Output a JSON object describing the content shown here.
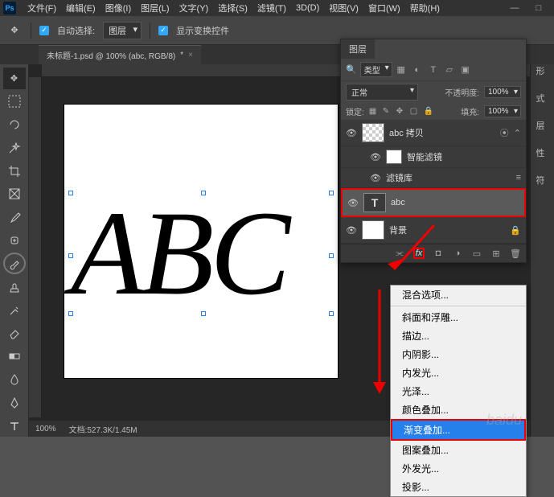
{
  "menu": [
    "文件(F)",
    "编辑(E)",
    "图像(I)",
    "图层(L)",
    "文字(Y)",
    "选择(S)",
    "滤镜(T)",
    "3D(D)",
    "视图(V)",
    "窗口(W)",
    "帮助(H)"
  ],
  "optbar": {
    "auto_select": "自动选择:",
    "layer": "图层",
    "show_transform": "显示变换控件"
  },
  "doctab": {
    "title": "未标题-1.psd @ 100% (abc, RGB/8)",
    "marker": "*"
  },
  "canvas": {
    "text": "ABC"
  },
  "status": {
    "zoom": "100%",
    "doc": "文档:527.3K/1.45M"
  },
  "panel_labels": [
    "形",
    "式",
    "层",
    "性",
    "符"
  ],
  "layers_panel": {
    "tab": "图层",
    "type_label": "类型",
    "blend": "正常",
    "opacity_label": "不透明度:",
    "opacity_val": "100%",
    "lock_label": "锁定:",
    "fill_label": "填充:",
    "fill_val": "100%",
    "layers": [
      {
        "name": "abc 拷贝"
      },
      {
        "name": "智能滤镜"
      },
      {
        "name": "滤镜库"
      },
      {
        "name": "abc"
      },
      {
        "name": "背景"
      }
    ],
    "fx_label": "fx"
  },
  "fx_menu": {
    "items": [
      "混合选项...",
      "斜面和浮雕...",
      "描边...",
      "内阴影...",
      "内发光...",
      "光泽...",
      "颜色叠加...",
      "渐变叠加...",
      "图案叠加...",
      "外发光...",
      "投影..."
    ],
    "highlight_index": 7
  },
  "watermark": "baidu"
}
